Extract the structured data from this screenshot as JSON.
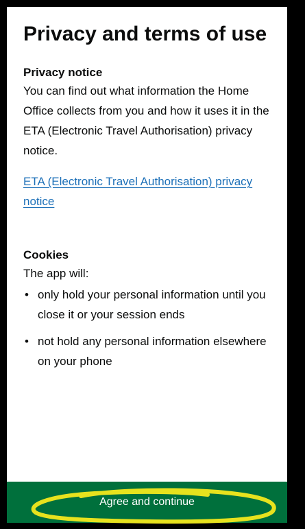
{
  "page": {
    "title": "Privacy and terms of use"
  },
  "privacy": {
    "heading": "Privacy notice",
    "text": "You can find out what information the Home Office collects from you and how it uses it in the ETA (Electronic Travel Authorisation) privacy notice.",
    "link_label": "ETA (Electronic Travel Authorisation) privacy notice"
  },
  "cookies": {
    "heading": "Cookies",
    "intro": "The app will:",
    "bullets": [
      "only hold your personal information until you close it or your session ends",
      "not hold any personal information elsewhere on your phone"
    ],
    "bullet_symbol": "•"
  },
  "footer": {
    "button_label": "Agree and continue"
  },
  "colors": {
    "link": "#1d70b8",
    "button_background": "#00703c",
    "highlight": "#f3e81c",
    "frame": "#000000"
  }
}
